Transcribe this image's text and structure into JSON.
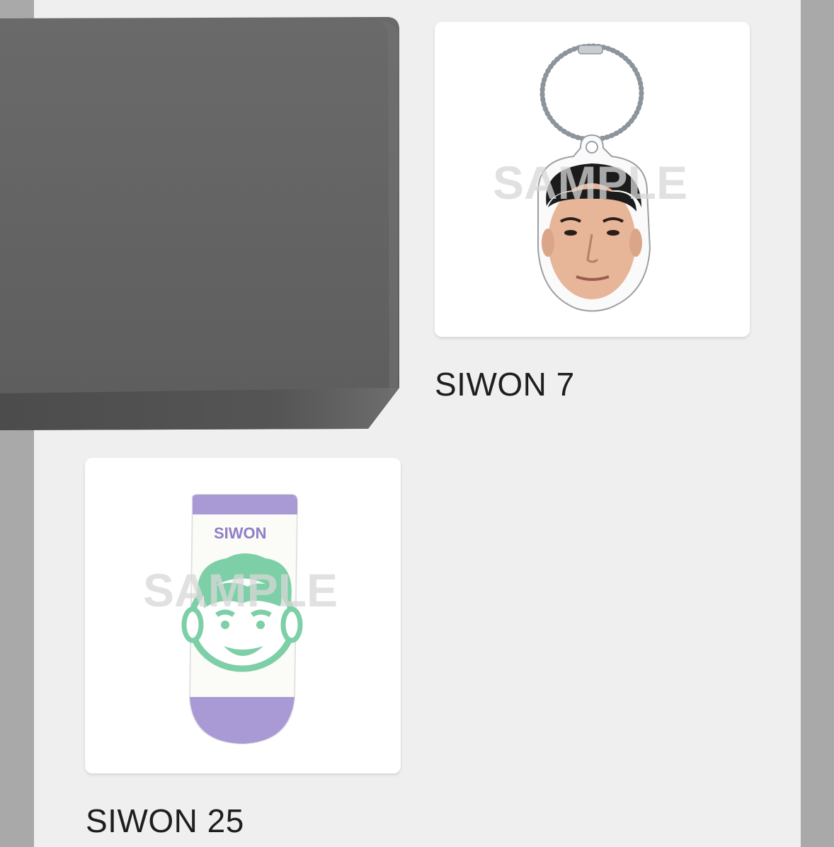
{
  "products": [
    {
      "name": "SIWON 7",
      "watermark": "SAMPLE",
      "image_icon": "acrylic-keyring-image"
    },
    {
      "name": "SIWON 25",
      "watermark": "SAMPLE",
      "sock_text": "SIWON",
      "image_icon": "ankle-socks-image"
    }
  ],
  "colors": {
    "page_background": "#efefef",
    "side_strip": "#a9a9a9",
    "card_background": "#ffffff",
    "box_gray": "#5f5f5f",
    "sock_purple": "#a99ad6",
    "sock_green": "#7ccfa6"
  }
}
